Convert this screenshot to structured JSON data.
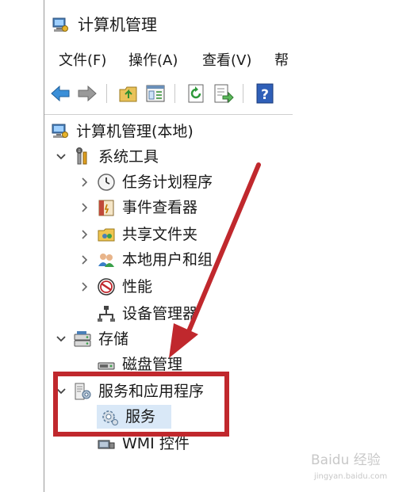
{
  "window": {
    "title": "计算机管理"
  },
  "menu": [
    {
      "label": "文件(F)"
    },
    {
      "label": "操作(A)"
    },
    {
      "label": "查看(V)"
    },
    {
      "label": "帮"
    }
  ],
  "toolbar": [
    {
      "icon": "back-arrow-icon"
    },
    {
      "icon": "forward-arrow-icon"
    },
    {
      "icon": "up-folder-icon"
    },
    {
      "icon": "show-hide-console-tree-icon"
    },
    {
      "icon": "refresh-icon"
    },
    {
      "icon": "export-list-icon"
    },
    {
      "icon": "help-icon"
    }
  ],
  "tree": {
    "root": {
      "label": "计算机管理(本地)"
    },
    "system_tools": {
      "label": "系统工具",
      "children": [
        {
          "label": "任务计划程序"
        },
        {
          "label": "事件查看器"
        },
        {
          "label": "共享文件夹"
        },
        {
          "label": "本地用户和组"
        },
        {
          "label": "性能"
        },
        {
          "label": "设备管理器"
        }
      ]
    },
    "storage": {
      "label": "存储",
      "children": [
        {
          "label": "磁盘管理"
        }
      ]
    },
    "services_apps": {
      "label": "服务和应用程序",
      "children": [
        {
          "label": "服务",
          "selected": true
        },
        {
          "label": "WMI 控件"
        }
      ]
    }
  },
  "annotation": {
    "arrow_color": "#c0282d",
    "box_color": "#c0282d"
  },
  "watermark": {
    "text": "Baidu 经验",
    "sub": "jingyan.baidu.com"
  }
}
